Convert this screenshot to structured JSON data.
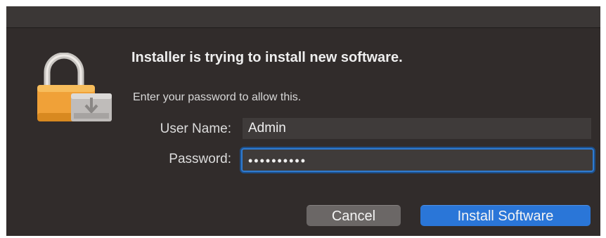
{
  "dialog": {
    "heading": "Installer is trying to install new software.",
    "subtext": "Enter your password to allow this.",
    "icon": "lock-icon"
  },
  "form": {
    "username_label": "User Name:",
    "username_value": "Admin",
    "password_label": "Password:",
    "password_value": "••••••••••"
  },
  "buttons": {
    "cancel_label": "Cancel",
    "install_label": "Install Software"
  },
  "colors": {
    "background": "#312c2b",
    "accent": "#2a76d8",
    "lock_body": "#f2a43a"
  }
}
